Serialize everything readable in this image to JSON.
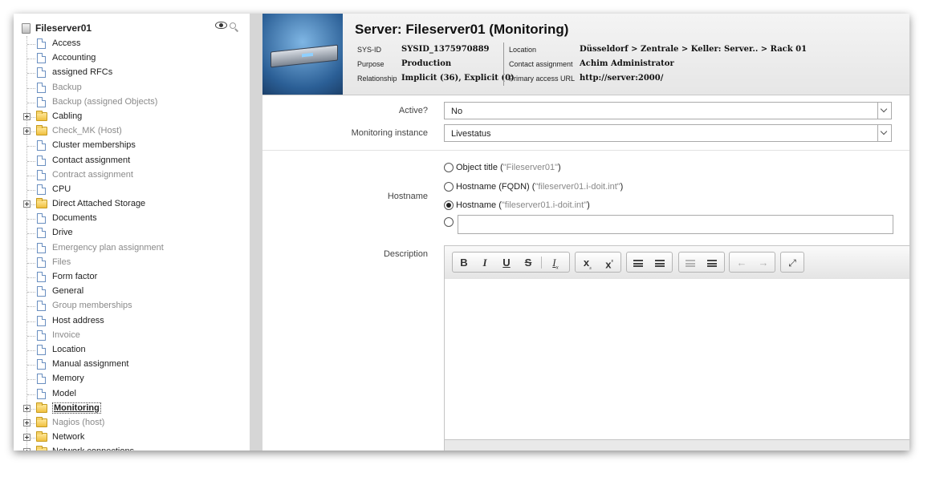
{
  "tree": {
    "root_label": "Fileserver01",
    "tools": [
      "eye-icon",
      "magnifier-icon"
    ],
    "items": [
      {
        "label": "Access",
        "kind": "doc",
        "state": "normal"
      },
      {
        "label": "Accounting",
        "kind": "doc",
        "state": "normal"
      },
      {
        "label": "assigned RFCs",
        "kind": "doc",
        "state": "normal"
      },
      {
        "label": "Backup",
        "kind": "doc",
        "state": "gray"
      },
      {
        "label": "Backup (assigned Objects)",
        "kind": "doc",
        "state": "gray"
      },
      {
        "label": "Cabling",
        "kind": "folder",
        "state": "normal"
      },
      {
        "label": "Check_MK (Host)",
        "kind": "folder",
        "state": "gray"
      },
      {
        "label": "Cluster memberships",
        "kind": "doc",
        "state": "normal"
      },
      {
        "label": "Contact assignment",
        "kind": "doc",
        "state": "normal"
      },
      {
        "label": "Contract assignment",
        "kind": "doc",
        "state": "gray"
      },
      {
        "label": "CPU",
        "kind": "doc",
        "state": "normal"
      },
      {
        "label": "Direct Attached Storage",
        "kind": "folder",
        "state": "normal"
      },
      {
        "label": "Documents",
        "kind": "doc",
        "state": "normal"
      },
      {
        "label": "Drive",
        "kind": "doc",
        "state": "normal"
      },
      {
        "label": "Emergency plan assignment",
        "kind": "doc",
        "state": "gray"
      },
      {
        "label": "Files",
        "kind": "doc",
        "state": "gray"
      },
      {
        "label": "Form factor",
        "kind": "doc",
        "state": "normal"
      },
      {
        "label": "General",
        "kind": "doc",
        "state": "normal"
      },
      {
        "label": "Group memberships",
        "kind": "doc",
        "state": "gray"
      },
      {
        "label": "Host address",
        "kind": "doc",
        "state": "normal"
      },
      {
        "label": "Invoice",
        "kind": "doc",
        "state": "gray"
      },
      {
        "label": "Location",
        "kind": "doc",
        "state": "normal"
      },
      {
        "label": "Manual assignment",
        "kind": "doc",
        "state": "normal"
      },
      {
        "label": "Memory",
        "kind": "doc",
        "state": "normal"
      },
      {
        "label": "Model",
        "kind": "doc",
        "state": "normal"
      },
      {
        "label": "Monitoring",
        "kind": "folder",
        "state": "selected"
      },
      {
        "label": "Nagios (host)",
        "kind": "folder",
        "state": "gray"
      },
      {
        "label": "Network",
        "kind": "folder",
        "state": "normal"
      },
      {
        "label": "Network connections",
        "kind": "folder",
        "state": "normal"
      }
    ]
  },
  "header": {
    "title": "Server: Fileserver01 (Monitoring)",
    "meta_left": [
      {
        "key": "SYS-ID",
        "value": "SYSID_1375970889"
      },
      {
        "key": "Purpose",
        "value": "Production"
      },
      {
        "key": "Relationship",
        "value": "Implicit (36), Explicit (0)"
      }
    ],
    "meta_right": [
      {
        "key": "Location",
        "value": "Düsseldorf > Zentrale > Keller: Server.. > Rack 01"
      },
      {
        "key": "Contact assignment",
        "value": "Achim Administrator"
      },
      {
        "key": "Primary access URL",
        "value": "http://server:2000/"
      }
    ]
  },
  "form": {
    "active": {
      "label": "Active?",
      "value": "No"
    },
    "instance": {
      "label": "Monitoring instance",
      "value": "Livestatus"
    },
    "hostname": {
      "label": "Hostname",
      "options": [
        {
          "text": "Object title",
          "hint": "Fileserver01",
          "selected": false
        },
        {
          "text": "Hostname (FQDN)",
          "hint": "fileserver01.i-doit.int",
          "selected": false
        },
        {
          "text": "Hostname",
          "hint": "fileserver01.i-doit.int",
          "selected": true
        }
      ],
      "custom_value": ""
    },
    "description": {
      "label": "Description",
      "value": "",
      "toolbar": [
        "bold",
        "italic",
        "underline",
        "strikethrough",
        "remove-format",
        "subscript",
        "superscript",
        "numbered-list",
        "bulleted-list",
        "decrease-indent",
        "increase-indent",
        "undo",
        "redo",
        "maximize"
      ]
    }
  },
  "colors": {
    "splitter": "#d6d6d6",
    "header_bg": "#eeeeee",
    "gray_text": "#8a8a8a",
    "tree_doc_border": "#6a8fc0"
  }
}
